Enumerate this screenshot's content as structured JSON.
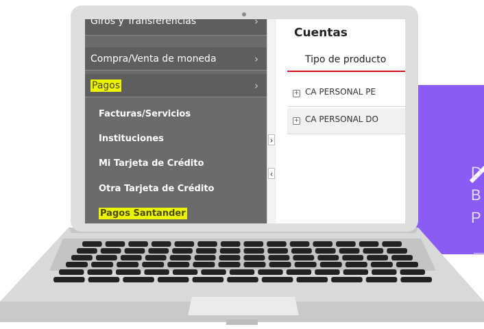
{
  "promo": {
    "lines": [
      "D",
      "B",
      "P"
    ]
  },
  "sidebar": {
    "menu_items": [
      {
        "label": "Giros y Transferencias"
      },
      {
        "label": "Compra/Venta de moneda"
      },
      {
        "label": "Pagos",
        "highlighted": true
      }
    ],
    "sub_items": [
      {
        "label": "Facturas/Servicios"
      },
      {
        "label": "Instituciones"
      },
      {
        "label": "Mi Tarjeta de Crédito"
      },
      {
        "label": "Otra Tarjeta de Crédito"
      },
      {
        "label": "Pagos Santander",
        "highlighted": true
      }
    ]
  },
  "main": {
    "title": "Cuentas",
    "column_header": "Tipo de producto",
    "rows": [
      {
        "label": "CA PERSONAL PE"
      },
      {
        "label": "CA PERSONAL DO"
      }
    ]
  },
  "colors": {
    "sidebar": "#5e5e5e",
    "highlight": "#ecf400",
    "accent_red": "#d3131a",
    "promo_purple": "#8a5cf5"
  }
}
